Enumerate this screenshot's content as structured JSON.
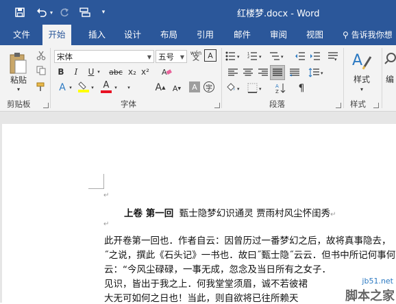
{
  "window": {
    "title": "红楼梦.docx - Word"
  },
  "qat": {
    "more": "▾"
  },
  "tabs": [
    "文件",
    "开始",
    "插入",
    "设计",
    "布局",
    "引用",
    "邮件",
    "审阅",
    "视图"
  ],
  "tell_me": "告诉我你想",
  "clipboard": {
    "paste_label": "粘贴",
    "group_label": "剪贴板"
  },
  "font": {
    "name": "宋体",
    "size": "五号",
    "wen_label": "wén",
    "group_label": "字体",
    "bold": "B",
    "italic": "I",
    "underline": "U",
    "strike": "abc",
    "sub": "x₂",
    "sup": "x²",
    "grow": "A",
    "shrink": "A",
    "char_shade": "A",
    "enclose": "字",
    "clear": "A",
    "effect": "A",
    "color": "A"
  },
  "paragraph": {
    "group_label": "段落"
  },
  "styles": {
    "label": "样式",
    "group_label": "样式",
    "edit_label": "编"
  },
  "colors": {
    "accent": "#2b579a",
    "highlight": "#ffff00",
    "font_color": "#e81123"
  },
  "document": {
    "mark": "↵",
    "heading_bold": "上卷 第一回",
    "heading_rest": "甄士隐梦幻识通灵  贾雨村风尘怀闺秀",
    "lines": [
      "此开卷第一回也．作者自云：因曾历过一番梦幻之后，故将真事隐去，",
      "˝之说，撰此《石头记》一书也．故曰˝甄士隐˝云云．但书中所记何事何",
      "云：“今风尘碌碌，一事无成，忽念及当日所有之女子．",
      "见识，皆出于我之上．何我堂堂须眉，诚不若彼裙",
      "大无可如何之日也！当此，则自欲将已往所赖天"
    ]
  },
  "watermark": {
    "site": "jb51.net",
    "brand": "脚本之家"
  }
}
